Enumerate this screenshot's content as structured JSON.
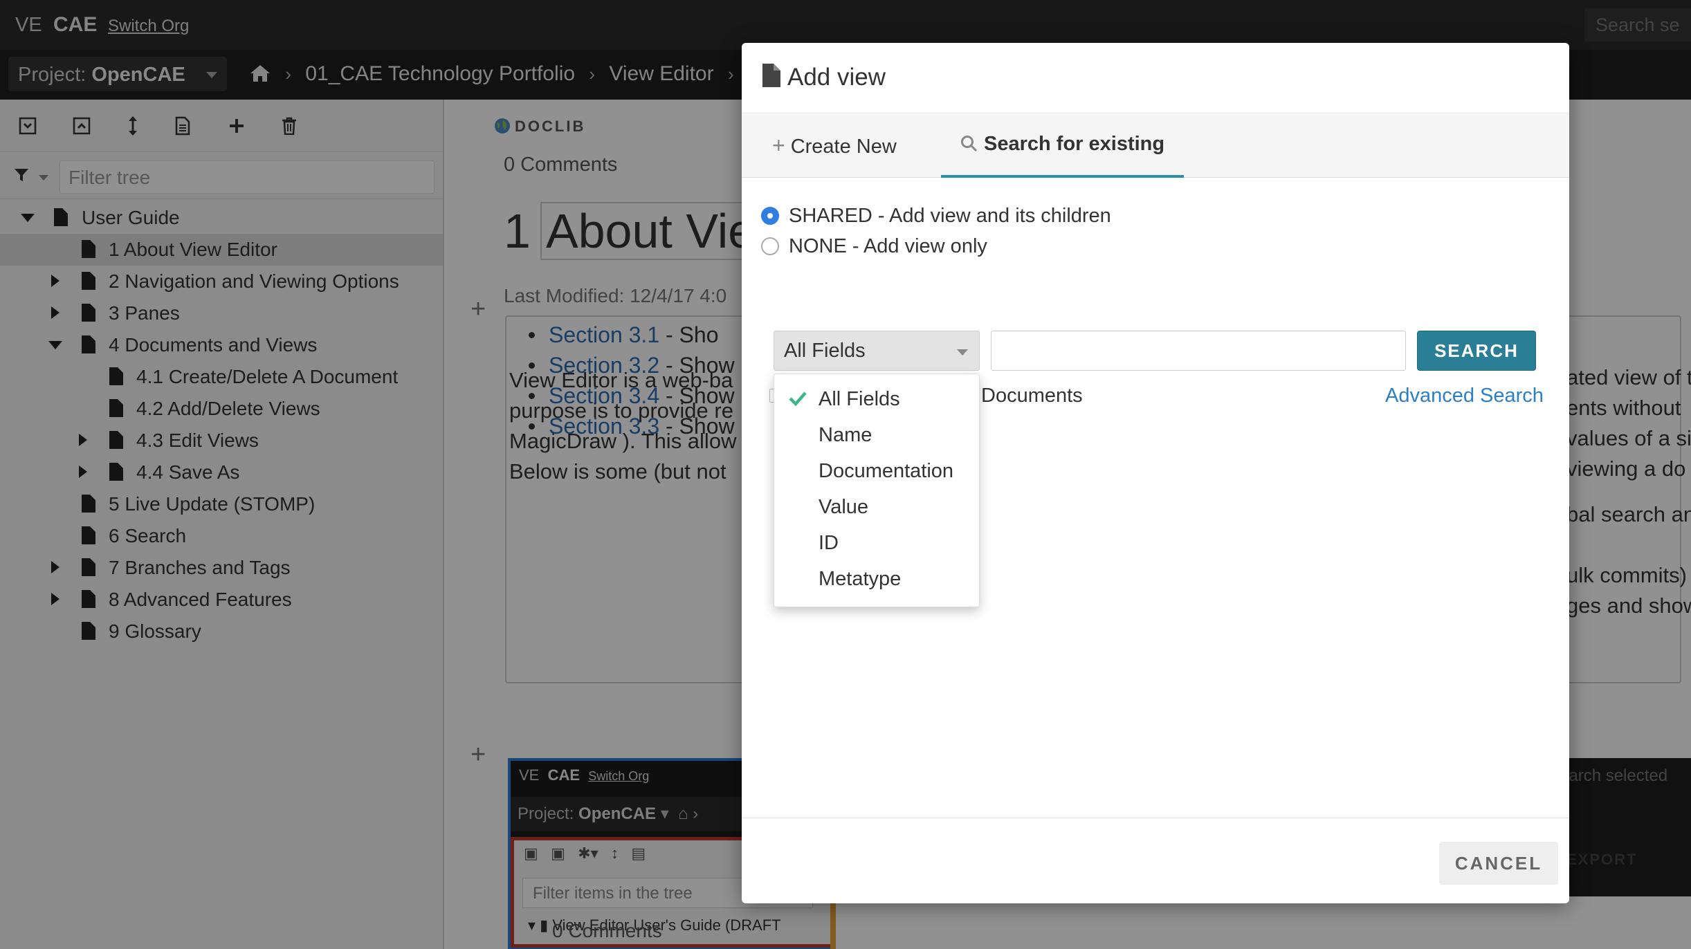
{
  "topbar": {
    "brand_ve": "VE",
    "brand_cae": "CAE",
    "switch_org": "Switch Org",
    "search_placeholder": "Search se"
  },
  "projectbar": {
    "project_prefix": "Project:",
    "project_name": "OpenCAE",
    "breadcrumbs": [
      "01_CAE Technology Portfolio",
      "View Editor"
    ]
  },
  "leftpane": {
    "filter_placeholder": "Filter tree",
    "tree": [
      {
        "label": "User Guide"
      },
      {
        "label": "1 About View Editor"
      },
      {
        "label": "2 Navigation and Viewing Options"
      },
      {
        "label": "3 Panes"
      },
      {
        "label": "4 Documents and Views"
      },
      {
        "label": "4.1 Create/Delete A Document"
      },
      {
        "label": "4.2 Add/Delete Views"
      },
      {
        "label": "4.3 Edit Views"
      },
      {
        "label": "4.4 Save As"
      },
      {
        "label": "5 Live Update (STOMP)"
      },
      {
        "label": "6 Search"
      },
      {
        "label": "7 Branches and Tags"
      },
      {
        "label": "8 Advanced Features"
      },
      {
        "label": "9 Glossary"
      }
    ]
  },
  "document": {
    "doclib": "DOCLIB",
    "comments": "0 Comments",
    "title_num": "1",
    "title_text": "About Vie",
    "last_modified": "Last Modified: 12/4/17 4:0",
    "paragraph": [
      "View Editor is a web-ba",
      "purpose is to provide re",
      "MagicDraw ). This allow",
      "Below is some (but not"
    ],
    "bullets": [
      {
        "link": "Section 3.1",
        "text": " - Sho"
      },
      {
        "link": "Section 3.2",
        "text": " - Show"
      },
      {
        "link": "Section 3.4",
        "text": " - Show"
      },
      {
        "link": "Section 3.3",
        "text": " - Show"
      }
    ],
    "right_text": [
      "ated view of t",
      "ents without",
      "values of a si",
      "viewing a do",
      "bal search an",
      "ulk commits)",
      "ges and show"
    ],
    "bottom_comments": "0 Comments",
    "right_search": "earch selected",
    "right_export": "EXPORT",
    "embedded": {
      "ve": "VE",
      "cae": "CAE",
      "switch_org": "Switch Org",
      "project_prefix": "Project:",
      "project_name": "OpenCAE",
      "filter_placeholder": "Filter items in the tree",
      "node": "View Editor User's Guide (DRAFT"
    }
  },
  "modal": {
    "title": "Add view",
    "tabs": [
      {
        "label": "Create New"
      },
      {
        "label": "Search for existing"
      }
    ],
    "radios": [
      {
        "label": "SHARED - Add view and its children",
        "checked": true
      },
      {
        "label": "NONE - Add view only",
        "checked": false
      }
    ],
    "field_select": "All Fields",
    "search_value": "",
    "search_button": "SEARCH",
    "documents_label": "Documents",
    "advanced_search": "Advanced Search",
    "dropdown_options": [
      "All Fields",
      "Name",
      "Documentation",
      "Value",
      "ID",
      "Metatype"
    ],
    "cancel_button": "CANCEL"
  },
  "colors": {
    "accent": "#2a7f96",
    "link": "#2b7fc4",
    "radio_on": "#2f7fe0",
    "check": "#3fb28f"
  }
}
